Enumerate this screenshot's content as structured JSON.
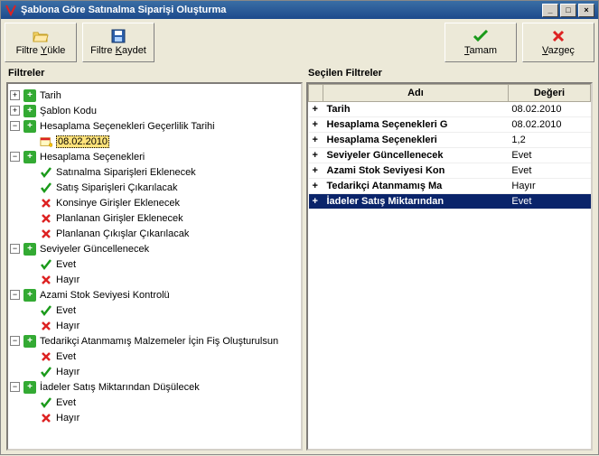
{
  "window": {
    "title": "Şablona Göre Satınalma Siparişi Oluşturma"
  },
  "toolbar": {
    "filter_load": "Filtre Yükle",
    "filter_save": "Filtre Kaydet",
    "ok": "Tamam",
    "cancel": "Vazgeç"
  },
  "left_panel": {
    "title": "Filtreler"
  },
  "right_panel": {
    "title": "Seçilen Filtreler"
  },
  "tree": [
    {
      "level": 0,
      "exp": "+",
      "icon": "plus",
      "label": "Tarih"
    },
    {
      "level": 0,
      "exp": "+",
      "icon": "plus",
      "label": "Şablon Kodu"
    },
    {
      "level": 0,
      "exp": "-",
      "icon": "plus",
      "label": "Hesaplama Seçenekleri Geçerlilik Tarihi"
    },
    {
      "level": 1,
      "exp": null,
      "icon": "cal",
      "label": "08.02.2010",
      "selected": true
    },
    {
      "level": 0,
      "exp": "-",
      "icon": "plus",
      "label": "Hesaplama Seçenekleri"
    },
    {
      "level": 1,
      "exp": null,
      "icon": "check",
      "label": "Satınalma Siparişleri Eklenecek"
    },
    {
      "level": 1,
      "exp": null,
      "icon": "check",
      "label": "Satış Siparişleri Çıkarılacak"
    },
    {
      "level": 1,
      "exp": null,
      "icon": "cross",
      "label": "Konsinye Girişler Eklenecek"
    },
    {
      "level": 1,
      "exp": null,
      "icon": "cross",
      "label": "Planlanan Girişler Eklenecek"
    },
    {
      "level": 1,
      "exp": null,
      "icon": "cross",
      "label": "Planlanan Çıkışlar Çıkarılacak"
    },
    {
      "level": 0,
      "exp": "-",
      "icon": "plus",
      "label": "Seviyeler Güncellenecek"
    },
    {
      "level": 1,
      "exp": null,
      "icon": "check",
      "label": "Evet"
    },
    {
      "level": 1,
      "exp": null,
      "icon": "cross",
      "label": "Hayır"
    },
    {
      "level": 0,
      "exp": "-",
      "icon": "plus",
      "label": "Azami Stok Seviyesi Kontrolü"
    },
    {
      "level": 1,
      "exp": null,
      "icon": "check",
      "label": "Evet"
    },
    {
      "level": 1,
      "exp": null,
      "icon": "cross",
      "label": "Hayır"
    },
    {
      "level": 0,
      "exp": "-",
      "icon": "plus",
      "label": "Tedarikçi Atanmamış Malzemeler İçin Fiş Oluşturulsun"
    },
    {
      "level": 1,
      "exp": null,
      "icon": "cross",
      "label": "Evet"
    },
    {
      "level": 1,
      "exp": null,
      "icon": "check",
      "label": "Hayır"
    },
    {
      "level": 0,
      "exp": "-",
      "icon": "plus",
      "label": "İadeler Satış Miktarından Düşülecek"
    },
    {
      "level": 1,
      "exp": null,
      "icon": "check",
      "label": "Evet"
    },
    {
      "level": 1,
      "exp": null,
      "icon": "cross",
      "label": "Hayır"
    }
  ],
  "grid": {
    "headers": {
      "name": "Adı",
      "value": "Değeri"
    },
    "rows": [
      {
        "name": "Tarih",
        "value": "08.02.2010"
      },
      {
        "name": "Hesaplama Seçenekleri G",
        "value": "08.02.2010"
      },
      {
        "name": "Hesaplama Seçenekleri",
        "value": "1,2"
      },
      {
        "name": "Seviyeler Güncellenecek",
        "value": "Evet"
      },
      {
        "name": "Azami Stok Seviyesi Kon",
        "value": "Evet"
      },
      {
        "name": "Tedarikçi Atanmamış Ma",
        "value": "Hayır"
      },
      {
        "name": "İadeler Satış Miktarından",
        "value": "Evet",
        "selected": true
      }
    ]
  }
}
